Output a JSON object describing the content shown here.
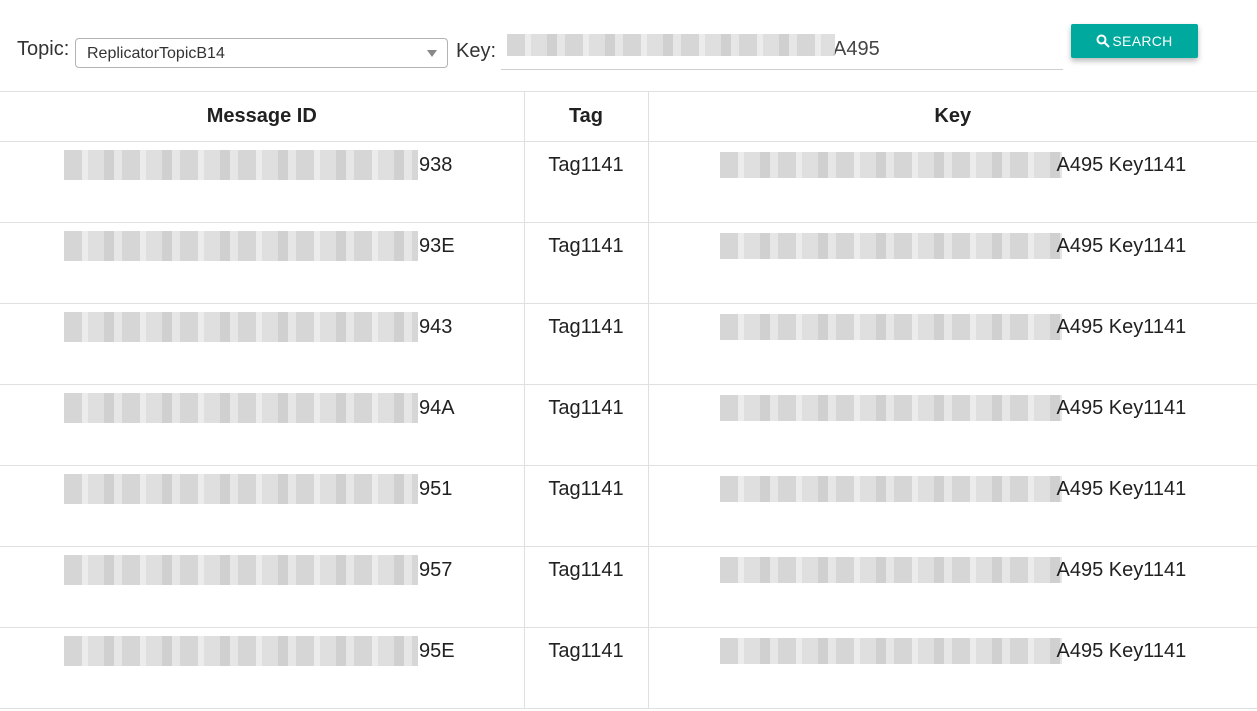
{
  "filters": {
    "topic_label": "Topic:",
    "topic_value": "ReplicatorTopicB14",
    "key_label": "Key:",
    "key_value_visible_suffix": "A495",
    "search_label": "SEARCH"
  },
  "table": {
    "headers": {
      "message_id": "Message ID",
      "tag": "Tag",
      "key": "Key"
    },
    "rows": [
      {
        "message_id_suffix": "938",
        "tag": "Tag1141",
        "key_suffix": "A495 Key1141"
      },
      {
        "message_id_suffix": "93E",
        "tag": "Tag1141",
        "key_suffix": "A495 Key1141"
      },
      {
        "message_id_suffix": "943",
        "tag": "Tag1141",
        "key_suffix": "A495 Key1141"
      },
      {
        "message_id_suffix": "94A",
        "tag": "Tag1141",
        "key_suffix": "A495 Key1141"
      },
      {
        "message_id_suffix": "951",
        "tag": "Tag1141",
        "key_suffix": "A495 Key1141"
      },
      {
        "message_id_suffix": "957",
        "tag": "Tag1141",
        "key_suffix": "A495 Key1141"
      },
      {
        "message_id_suffix": "95E",
        "tag": "Tag1141",
        "key_suffix": "A495 Key1141"
      }
    ]
  },
  "colors": {
    "accent": "#00a99d",
    "border": "#e0e0e0"
  },
  "icons": {
    "search": "search-icon",
    "dropdown": "chevron-down-icon"
  }
}
